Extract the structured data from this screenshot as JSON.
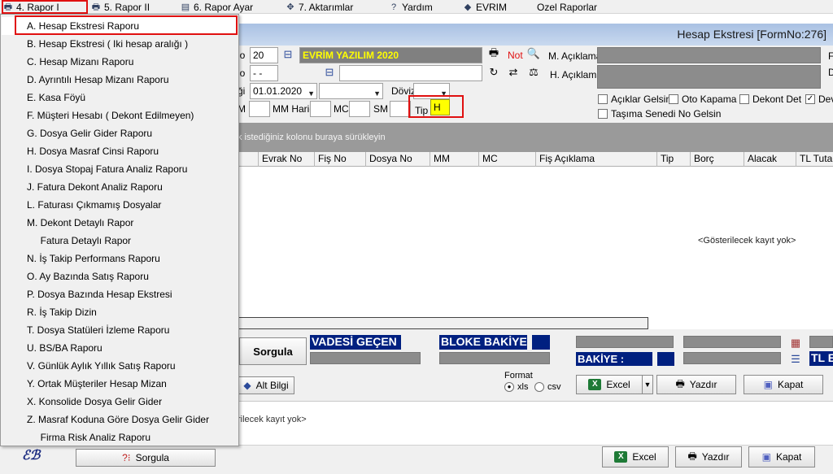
{
  "menubar": {
    "items": [
      {
        "label": "4.  Rapor I",
        "icon": "printer-icon"
      },
      {
        "label": "5.   Rapor II",
        "icon": "printer-icon"
      },
      {
        "label": "6.   Rapor Ayar",
        "icon": "report-settings-icon"
      },
      {
        "label": "7.   Aktarımlar",
        "icon": "transfer-icon"
      },
      {
        "label": "Yardım",
        "icon": "help-icon"
      },
      {
        "label": "EVRIM",
        "icon": "evrim-icon"
      },
      {
        "label": "Ozel Raporlar",
        "icon": ""
      }
    ]
  },
  "dropdown": {
    "items": [
      "A.   Hesap Ekstresi Raporu",
      "B.   Hesap Ekstresi ( Iki hesap aralığı )",
      "C.   Hesap Mizanı Raporu",
      "D.   Ayrıntılı Hesap Mizanı Raporu",
      "E.   Kasa Föyü",
      "F.   Müşteri Hesabı ( Dekont Edilmeyen)",
      "G.   Dosya Gelir Gider Raporu",
      "H.   Dosya Masraf Cinsi Raporu",
      "I.   Dosya Stopaj Fatura Analiz Raporu",
      "J.   Fatura Dekont Analiz Raporu",
      "L.   Faturası Çıkmamış Dosyalar",
      "M.   Dekont Detaylı Rapor",
      "     Fatura Detaylı Rapor",
      "N.   İş Takip Performans Raporu",
      "O.   Ay Bazında Satış Raporu",
      "P.   Dosya Bazında Hesap Ekstresi",
      "R.   İş Takip Dizin",
      "T.   Dosya Statüleri İzleme Raporu",
      "U.   BS/BA Raporu",
      "V. Günlük Aylık Yıllık Satış Raporu",
      "Y. Ortak Müşteriler Hesap Mizan",
      "X. Konsolide Dosya Gelir Gider",
      "Z. Masraf Koduna Göre Dosya Gelir Gider",
      "     Firma Risk Analiz Raporu"
    ]
  },
  "window": {
    "title": "Hesap Ekstresi [FormNo:276]"
  },
  "form": {
    "label_no": "lo",
    "no_value": "20",
    "company": "EVRİM YAZILIM  2020",
    "not_label": "Not",
    "label_row2": "lo",
    "row2_value": " -  - ",
    "m_aciklama_label": "M. Açıklama",
    "h_aciklama_label": "H. Açıklama",
    "label_date": "ği",
    "date_value": "01.01.2020",
    "doviz_label": "Döviz",
    "m_label": "M",
    "mm_haric_label": "MM Hariç",
    "mc_label": "MC",
    "sm_label": "SM",
    "tip_label": "Tip",
    "tip_value": "H",
    "right_edge_1": "F",
    "right_edge_2": "D",
    "checks": [
      {
        "label": "Açıklar Gelsin",
        "checked": false
      },
      {
        "label": "Oto Kapama",
        "checked": false
      },
      {
        "label": "Dekont Det",
        "checked": false
      },
      {
        "label": "Dev",
        "checked": true
      },
      {
        "label": "Taşıma Senedi No Gelsin",
        "checked": false
      }
    ]
  },
  "group_text": "k istediğiniz kolonu buraya sürükleyin",
  "grid": {
    "columns": [
      "Evrak No",
      "Fiş No",
      "Dosya No",
      "MM",
      "MC",
      "Fiş Açıklama",
      "Tip",
      "Borç",
      "Alacak",
      "TL Tutar"
    ],
    "empty_text": "<Gösterilecek kayıt yok>"
  },
  "summary": {
    "sorgula": "Sorgula",
    "vadesi_gecen": "VADESİ GEÇEN",
    "bloke_bakiye": "BLOKE BAKİYE",
    "bakiye": "BAKİYE   :",
    "tl": "TL E"
  },
  "actions": {
    "alt_bilgi": "Alt Bilgi",
    "format_label": "Format",
    "format_options": [
      "xls",
      "csv"
    ],
    "format_selected": "xls",
    "excel": "Excel",
    "yazdir": "Yazdır",
    "kapat": "Kapat"
  },
  "lower_empty_text": "rilecek kayıt yok>",
  "footer": {
    "sorgula": "Sorgula",
    "excel": "Excel",
    "yazdir": "Yazdır",
    "kapat": "Kapat"
  },
  "colors": {
    "navy": "#002080",
    "title_gradient": "#a9c1e3",
    "highlight_red": "#e01010",
    "company_yellow": "#ffff00"
  }
}
